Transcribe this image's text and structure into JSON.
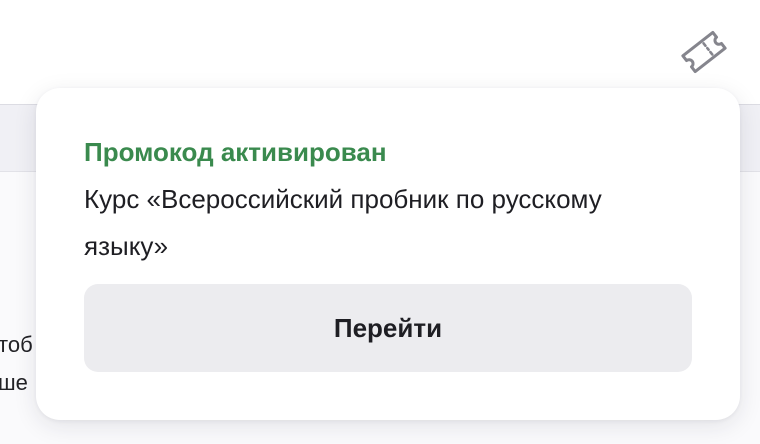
{
  "header": {
    "promo_icon": "ticket-icon"
  },
  "page": {
    "partial_line_1": "тоб",
    "partial_line_2": "ше"
  },
  "popup": {
    "title": "Промокод активирован",
    "body": "Курс «Всероссийский пробник по русскому языку»",
    "button_label": "Перейти"
  },
  "colors": {
    "title_green": "#3a8a4e",
    "button_bg": "#ececef",
    "page_bg": "#f0f0f5"
  }
}
